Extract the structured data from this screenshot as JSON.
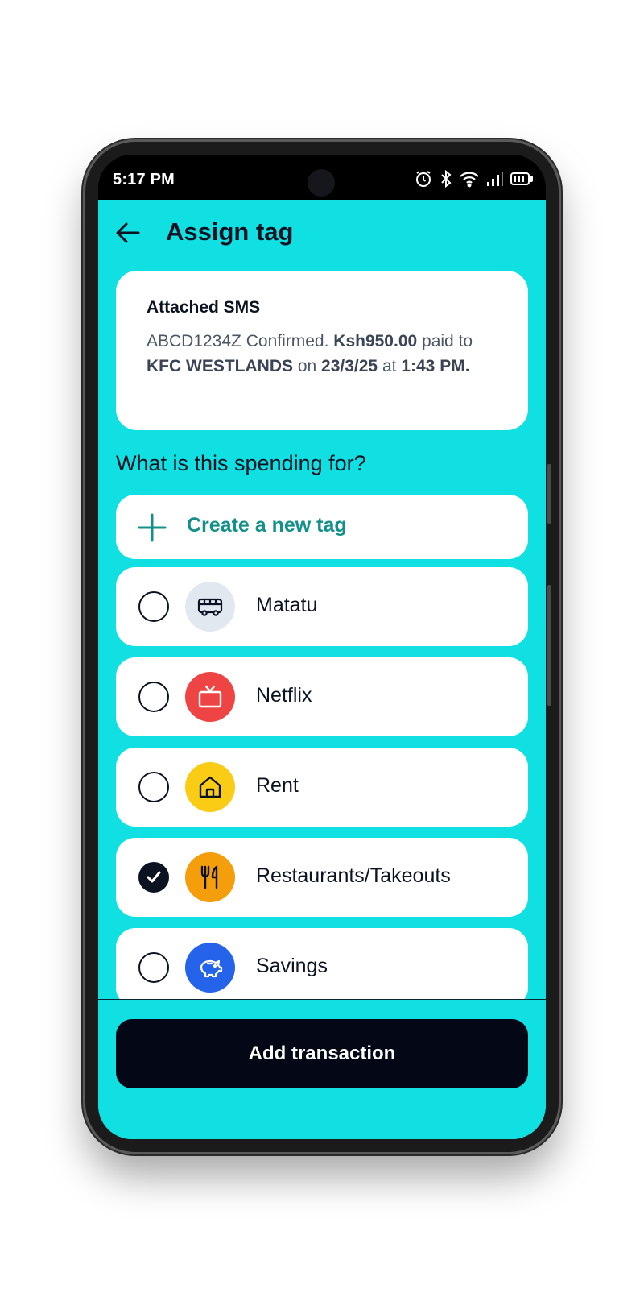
{
  "status_bar": {
    "time": "5:17 PM"
  },
  "header": {
    "title": "Assign tag"
  },
  "sms": {
    "heading": "Attached SMS",
    "code": "ABCD1234Z Confirmed.",
    "amount": "Ksh950.00",
    "paid": "paid",
    "to": "to",
    "merchant": "KFC WESTLANDS",
    "on": "on",
    "date": "23/3/25",
    "at": "at",
    "time": "1:43 PM."
  },
  "question": "What is this spending for?",
  "create_tag_label": "Create a new tag",
  "tags": [
    {
      "label": "Matatu",
      "icon": "bus-icon",
      "color": "#e2e8f0",
      "checked": false
    },
    {
      "label": "Netflix",
      "icon": "tv-icon",
      "color": "#ef4444",
      "checked": false
    },
    {
      "label": "Rent",
      "icon": "house-icon",
      "color": "#facc15",
      "checked": false
    },
    {
      "label": "Restaurants/Takeouts",
      "icon": "fork-knife-icon",
      "color": "#f59e0b",
      "checked": true
    },
    {
      "label": "Savings",
      "icon": "piggy-bank-icon",
      "color": "#2563eb",
      "checked": false
    }
  ],
  "submit_label": "Add transaction",
  "colors": {
    "background": "#10e0e2",
    "primary_dark": "#040816",
    "accent_text": "#139089"
  }
}
